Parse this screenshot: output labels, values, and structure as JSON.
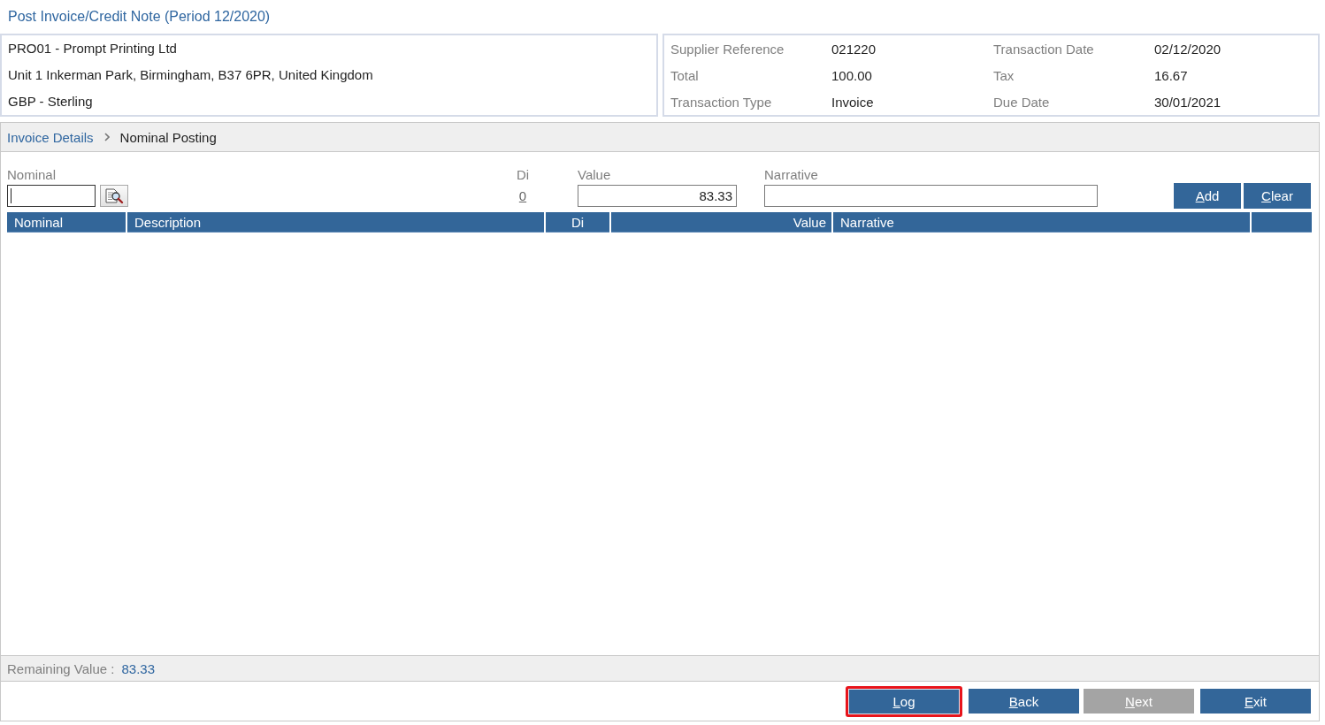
{
  "title": "Post Invoice/Credit Note (Period 12/2020)",
  "supplier": {
    "lines": [
      "PRO01 - Prompt Printing Ltd",
      "Unit 1 Inkerman Park, Birmingham, B37 6PR, United Kingdom",
      "GBP - Sterling"
    ]
  },
  "details": [
    {
      "label": "Supplier Reference",
      "value": "021220"
    },
    {
      "label": "Transaction Date",
      "value": "02/12/2020"
    },
    {
      "label": "Total",
      "value": "100.00"
    },
    {
      "label": "Tax",
      "value": "16.67"
    },
    {
      "label": "Transaction Type",
      "value": "Invoice"
    },
    {
      "label": "Due Date",
      "value": "30/01/2021"
    }
  ],
  "breadcrumb": [
    {
      "label": "Invoice Details",
      "kind": "link"
    },
    {
      "label": "Nominal Posting",
      "kind": "current"
    }
  ],
  "entry": {
    "nominal": {
      "label": "Nominal",
      "focused": true
    },
    "di": {
      "label": "Di",
      "value": "0"
    },
    "value": {
      "label": "Value",
      "value": "83.33"
    },
    "narrative": {
      "label": "Narrative"
    },
    "buttons": [
      {
        "label": "Add"
      },
      {
        "label": "Clear"
      }
    ]
  },
  "table": {
    "columns": [
      "Nominal",
      "Description",
      "Di",
      "Value",
      "Narrative"
    ]
  },
  "remaining": {
    "label": "Remaining Value :",
    "value": "83.33"
  },
  "actions": [
    {
      "label": "Log",
      "disabled": false,
      "highlighted": true
    },
    {
      "label": "Back",
      "disabled": false,
      "highlighted": false
    },
    {
      "label": "Next",
      "disabled": true,
      "highlighted": false
    },
    {
      "label": "Exit",
      "disabled": false,
      "highlighted": false
    }
  ]
}
